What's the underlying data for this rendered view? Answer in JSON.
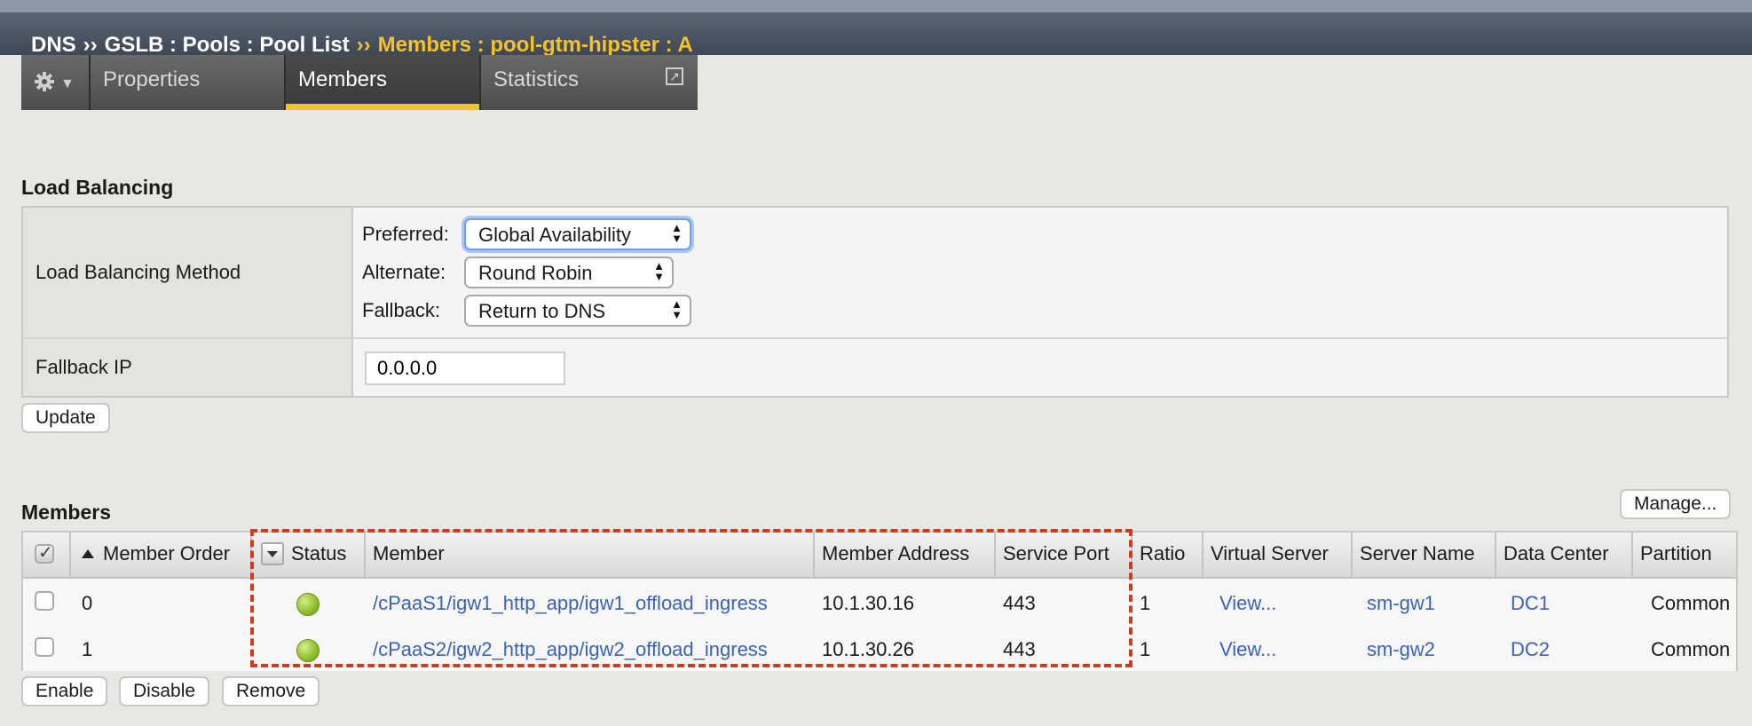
{
  "breadcrumb": {
    "part1": "DNS",
    "sep1": "››",
    "part2": "GSLB : Pools : Pool List",
    "sep2": "››",
    "part3": "Members : pool-gtm-hipster : A"
  },
  "tabs": {
    "gear_icon": "gear-icon",
    "properties": "Properties",
    "members": "Members",
    "statistics": "Statistics",
    "active": "Members",
    "accent_color": "#f2c230"
  },
  "load_balancing": {
    "title": "Load Balancing",
    "method_label": "Load Balancing Method",
    "preferred_label": "Preferred:",
    "preferred_value": "Global Availability",
    "alternate_label": "Alternate:",
    "alternate_value": "Round Robin",
    "fallback_label": "Fallback:",
    "fallback_value": "Return to DNS",
    "fallback_ip_label": "Fallback IP",
    "fallback_ip_value": "0.0.0.0",
    "update_button": "Update"
  },
  "members": {
    "title": "Members",
    "manage_button": "Manage...",
    "columns": {
      "member_order": "Member Order",
      "status": "Status",
      "member": "Member",
      "member_address": "Member Address",
      "service_port": "Service Port",
      "ratio": "Ratio",
      "virtual_server": "Virtual Server",
      "server_name": "Server Name",
      "data_center": "Data Center",
      "partition": "Partition"
    },
    "rows": [
      {
        "order": "0",
        "status": "available",
        "member": "/cPaaS1/igw1_http_app/igw1_offload_ingress",
        "address": "10.1.30.16",
        "port": "443",
        "ratio": "1",
        "virtual_server": "View...",
        "server_name": "sm-gw1",
        "data_center": "DC1",
        "partition": "Common"
      },
      {
        "order": "1",
        "status": "available",
        "member": "/cPaaS2/igw2_http_app/igw2_offload_ingress",
        "address": "10.1.30.26",
        "port": "443",
        "ratio": "1",
        "virtual_server": "View...",
        "server_name": "sm-gw2",
        "data_center": "DC2",
        "partition": "Common"
      }
    ],
    "buttons": {
      "enable": "Enable",
      "disable": "Disable",
      "remove": "Remove"
    },
    "status_color": "#8cbd2a",
    "highlight_color": "#d43a1a"
  }
}
